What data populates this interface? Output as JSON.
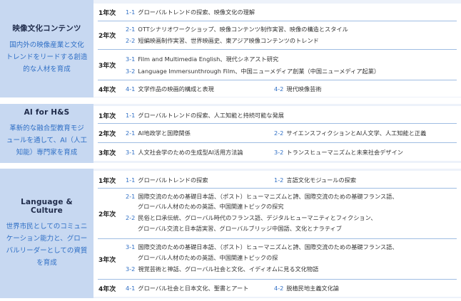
{
  "sections": [
    {
      "title": "映像文化コンテンツ",
      "desc": [
        "国内外の映像産業と文化",
        "トレンドをリードする創造",
        "的な人材を育成"
      ],
      "rows": [
        {
          "year": "1年次",
          "items": [
            {
              "num": "1-1",
              "text": "グローバルトレンドの探索、映像文化の理解"
            }
          ]
        },
        {
          "year": "2年次",
          "items": [
            {
              "num": "2-1",
              "text": "OTTシナリオワークショップ、映像コンテンツ制作実習、映像の構造とスタイル"
            },
            {
              "num": "2-2",
              "text": "短編映画制作実習、世界映画史、東アジア映像コンテンツのトレンド"
            }
          ]
        },
        {
          "year": "3年次",
          "items": [
            {
              "num": "3-1",
              "text": "Film and Multimedia English、現代シネアスト研究"
            },
            {
              "num": "3-2",
              "text": "Language Immersunthrough Film、中国ニューメディア創業（中国ニューメディア起業）"
            }
          ]
        },
        {
          "year": "4年次",
          "items": [
            {
              "num": "4-1",
              "text": "文学作品の映画的構成と表現"
            },
            {
              "num": "4-2",
              "text": "現代映像芸術"
            }
          ]
        }
      ]
    },
    {
      "title": "AI for H&S",
      "desc": [
        "革新的な融合型教育モジ",
        "ュールを通して、AI（人工",
        "知能）専門家を育成"
      ],
      "rows": [
        {
          "year": "1年次",
          "items": [
            {
              "num": "1-1",
              "text": "グローバルトレンドの探索、人工知能と持続可能な発展"
            }
          ]
        },
        {
          "year": "2年次",
          "items": [
            {
              "num": "2-1",
              "text": "AI地政学と国際関係"
            },
            {
              "num": "2-2",
              "text": "サイエンスフィクションとAI人文学、人工知能と正義"
            }
          ]
        },
        {
          "year": "3年次",
          "items": [
            {
              "num": "3-1",
              "text": "人文社会学のための生成型AI活用方法論"
            },
            {
              "num": "3-2",
              "text": "トランスヒューマニズムと未来社会デザイン"
            }
          ]
        }
      ]
    },
    {
      "title": "Language & Culture",
      "desc": [
        "世界市民としてのコミュニ",
        "ケーション能力と、グロー",
        "バルリーダーとしての資質",
        "を育成"
      ],
      "rows": [
        {
          "year": "1年次",
          "items": [
            {
              "num": "1-1",
              "text": "グローバルトレンドの探索"
            },
            {
              "num": "1-2",
              "text": "言語文化モジュールの探索"
            }
          ]
        },
        {
          "year": "2年次",
          "items": [
            {
              "num": "2-1",
              "text": "国際交流のための基礎日本語、（ポスト）ヒューマニズムと詩、国際交流のための基礎フランス語、"
            },
            {
              "num": "",
              "text": "グローバル人材のための英語、中国関連トピックの探究"
            },
            {
              "num": "2-2",
              "text": "民俗と口承伝統、グローバル時代のフランス語、デジタルヒューマニティとフィクション、"
            },
            {
              "num": "",
              "text": "グローバル交流と日本語実習、グローバルブリッジ中国語、文化とナラティブ"
            }
          ]
        },
        {
          "year": "3年次",
          "items": [
            {
              "num": "3-1",
              "text": "国際交流のための基礎日本語、（ポスト）ヒューマニズムと詩、国際交流のための基礎フランス語、"
            },
            {
              "num": "",
              "text": "グローバル人材のための英語、中国関連トピックの探"
            },
            {
              "num": "3-2",
              "text": "視覚芸術と神話、グローバル社会と文化、イディオムに見る文化物語"
            }
          ]
        },
        {
          "year": "4年次",
          "items": [
            {
              "num": "4-1",
              "text": "グローバル社会と日本文化、聖書とアート"
            },
            {
              "num": "4-2",
              "text": "脱植民地主義文化論"
            }
          ]
        }
      ]
    }
  ]
}
